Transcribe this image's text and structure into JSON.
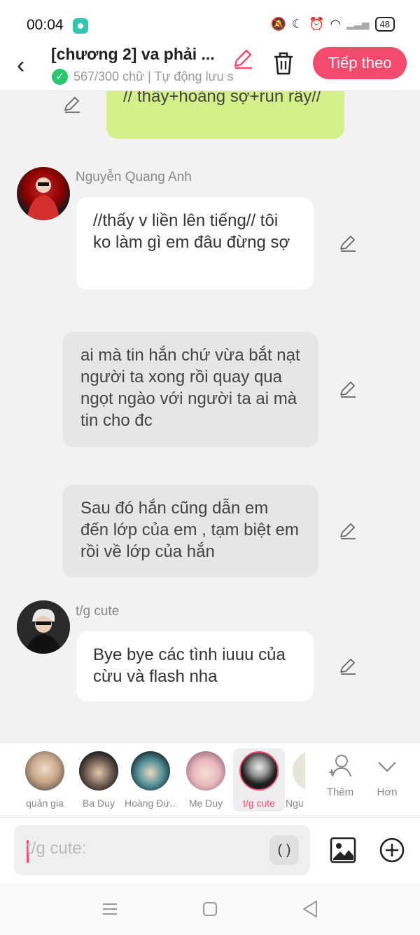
{
  "status_bar": {
    "time": "00:04",
    "battery": "48"
  },
  "header": {
    "title": "[chương 2] va phải ...",
    "subtitle": "567/300 chữ | Tự động lưu s",
    "next_label": "Tiếp theo"
  },
  "messages": [
    {
      "type": "narration-green",
      "text": "// thấy+hoảng sợ+run rẩy//"
    },
    {
      "type": "character",
      "name": "Nguyễn Quang Anh",
      "text": "//thấy v liền lên tiếng// tôi ko làm gì em đâu đừng sợ"
    },
    {
      "type": "narration",
      "text": "ai mà tin hắn chứ vừa bắt nạt người ta xong rồi quay qua ngọt ngào với người ta ai mà tin cho đc"
    },
    {
      "type": "narration",
      "text": "Sau đó hắn cũng dẫn em đến lớp của em ,  tạm biệt em rồi về lớp của hắn"
    },
    {
      "type": "character",
      "name": "t/g cute",
      "text": "Bye bye các tình iuuu của cừu và flash nha"
    }
  ],
  "characters": [
    {
      "label": "quản gia"
    },
    {
      "label": "Ba Duy"
    },
    {
      "label": "Hoàng Đứ..."
    },
    {
      "label": "Mẹ Duy"
    },
    {
      "label": "t/g cute",
      "selected": true
    },
    {
      "label": "Ngu"
    }
  ],
  "actions": {
    "add_label": "Thêm",
    "more_label": "Hơn"
  },
  "input": {
    "placeholder": "t/g cute:",
    "paren_label": "( )"
  },
  "colors": {
    "accent": "#f44a6e",
    "green_bubble": "#d3f08b",
    "success": "#28c76f"
  }
}
